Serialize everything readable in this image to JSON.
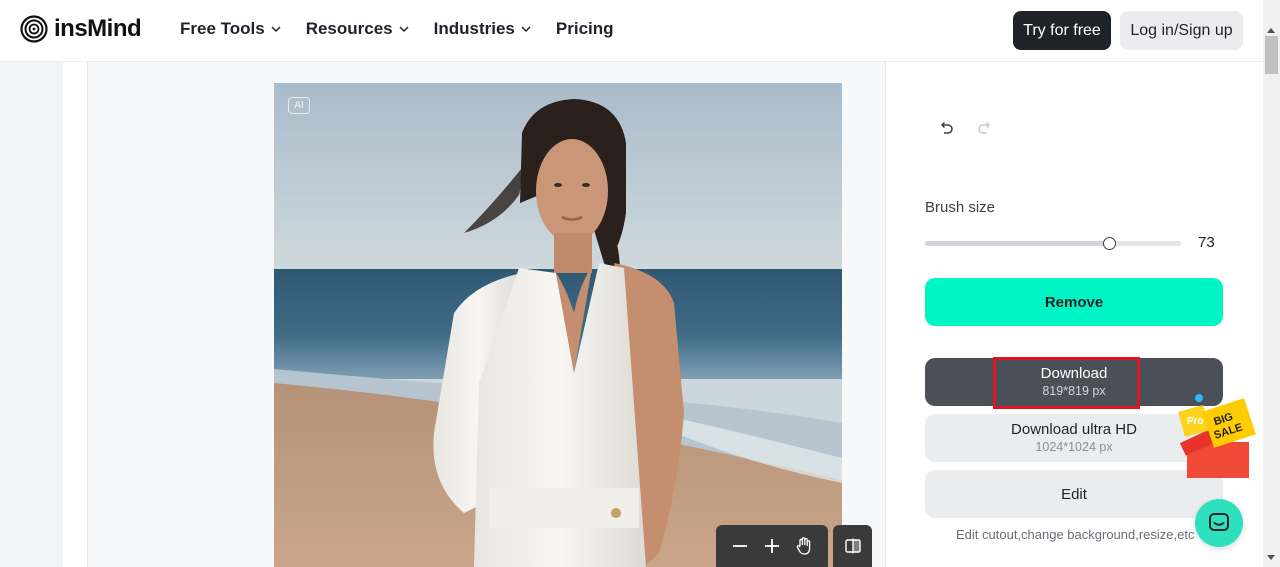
{
  "brand": {
    "name": "insMind"
  },
  "nav": {
    "items": [
      {
        "label": "Free Tools",
        "has_dropdown": true
      },
      {
        "label": "Resources",
        "has_dropdown": true
      },
      {
        "label": "Industries",
        "has_dropdown": true
      },
      {
        "label": "Pricing",
        "has_dropdown": false
      }
    ]
  },
  "header": {
    "try_label": "Try for free",
    "login_label": "Log in/Sign up"
  },
  "canvas": {
    "ai_badge": "AI",
    "image": "photo of woman in white dress on beach"
  },
  "toolbar": {
    "icons": [
      "zoom-out-icon",
      "zoom-in-icon",
      "hand-icon",
      "compare-icon"
    ]
  },
  "panel": {
    "brush_label": "Brush size",
    "brush_value": "73",
    "brush_fraction": 0.72,
    "remove_label": "Remove",
    "download_title": "Download",
    "download_size": "819*819 px",
    "ultra_title": "Download ultra HD",
    "ultra_size": "1024*1024 px",
    "edit_label": "Edit",
    "edit_desc": "Edit cutout,change background,resize,etc"
  },
  "promo": {
    "text_big": "BIG",
    "text_sale": "SALE",
    "text_pro": "Pro"
  },
  "colors": {
    "accent": "#00f5c4",
    "dark": "#1f2329",
    "download_bg": "#4a4f58",
    "highlight": "#e0141e",
    "chat": "#2de1bf"
  }
}
